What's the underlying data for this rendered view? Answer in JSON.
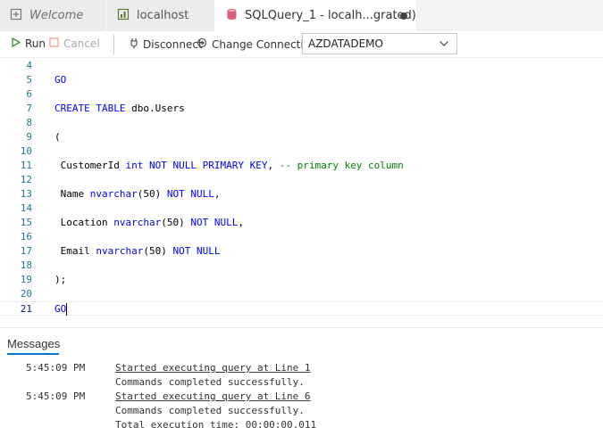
{
  "tabs": [
    {
      "label": "Welcome",
      "icon": "welcome-icon"
    },
    {
      "label": "localhost",
      "icon": "dashboard-icon"
    },
    {
      "label": "SQLQuery_1 - localh...grated)",
      "icon": "sql-file-icon",
      "dirty": true
    }
  ],
  "toolbar": {
    "run_label": "Run",
    "cancel_label": "Cancel",
    "disconnect_label": "Disconnect",
    "change_connection_label": "Change Connection",
    "database": "AZDATADEMO"
  },
  "editor": {
    "current_line": 21,
    "lines": [
      {
        "num": "4",
        "code": ""
      },
      {
        "num": "5",
        "code": "GO"
      },
      {
        "num": "6",
        "code": ""
      },
      {
        "num": "7",
        "code": "CREATE TABLE dbo.Users"
      },
      {
        "num": "8",
        "code": ""
      },
      {
        "num": "9",
        "code": "("
      },
      {
        "num": "10",
        "code": ""
      },
      {
        "num": "11",
        "code": " CustomerId int NOT NULL PRIMARY KEY, -- primary key column"
      },
      {
        "num": "12",
        "code": ""
      },
      {
        "num": "13",
        "code": " Name nvarchar(50) NOT NULL,"
      },
      {
        "num": "14",
        "code": ""
      },
      {
        "num": "15",
        "code": " Location nvarchar(50) NOT NULL,"
      },
      {
        "num": "16",
        "code": ""
      },
      {
        "num": "17",
        "code": " Email nvarchar(50) NOT NULL"
      },
      {
        "num": "18",
        "code": ""
      },
      {
        "num": "19",
        "code": ");"
      },
      {
        "num": "20",
        "code": ""
      },
      {
        "num": "21",
        "code": "GO"
      }
    ]
  },
  "messages": {
    "title": "Messages",
    "rows": [
      {
        "time": "5:45:09 PM",
        "text": "Started executing query at Line 1",
        "link": true
      },
      {
        "time": "",
        "text": "Commands completed successfully.",
        "link": false
      },
      {
        "time": "5:45:09 PM",
        "text": "Started executing query at Line 6",
        "link": true
      },
      {
        "time": "",
        "text": "Commands completed successfully.",
        "link": false
      },
      {
        "time": "",
        "text": "Total execution time: 00:00:00.011",
        "link": false
      }
    ]
  },
  "colors": {
    "accent": "#0078d4",
    "keyword": "#0000ff",
    "comment": "#008000",
    "line_number": "#237893"
  }
}
